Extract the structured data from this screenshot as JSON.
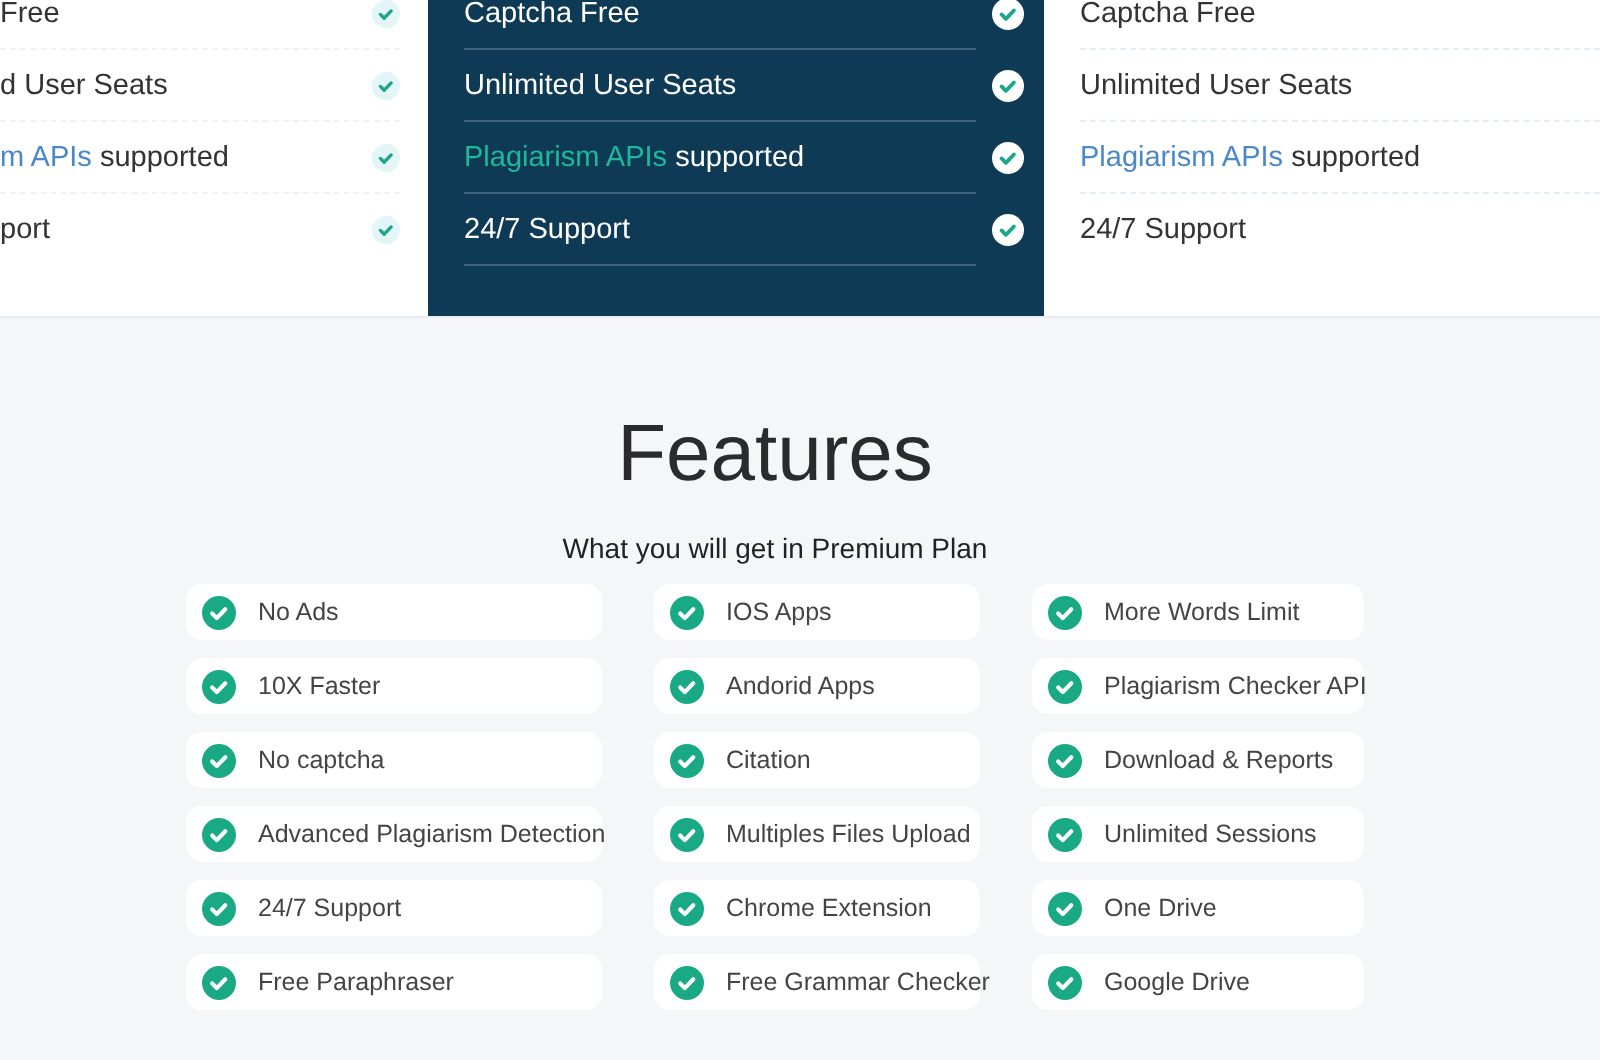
{
  "plans": [
    {
      "kind": "plain",
      "items": [
        {
          "text": "Free"
        },
        {
          "text": "d User Seats"
        },
        {
          "link": "m APIs",
          "text": " supported"
        },
        {
          "text": "port"
        }
      ]
    },
    {
      "kind": "featured",
      "items": [
        {
          "text": "Captcha Free"
        },
        {
          "text": "Unlimited User Seats"
        },
        {
          "link": "Plagiarism APIs",
          "text": " supported"
        },
        {
          "text": "24/7 Support"
        }
      ]
    },
    {
      "kind": "cut",
      "items": [
        {
          "text": "Captcha Free"
        },
        {
          "text": "Unlimited User Seats"
        },
        {
          "link": "Plagiarism APIs",
          "text": " supported"
        },
        {
          "text": "24/7 Support"
        }
      ]
    }
  ],
  "features": {
    "title": "Features",
    "subtitle": "What you will get in Premium Plan",
    "columns": [
      [
        "No Ads",
        "10X Faster",
        "No captcha",
        "Advanced Plagiarism Detection",
        "24/7 Support",
        "Free Paraphraser"
      ],
      [
        "IOS Apps",
        "Andorid Apps",
        "Citation",
        "Multiples Files Upload",
        "Chrome Extension",
        "Free Grammar Checker"
      ],
      [
        "More Words Limit",
        "Plagiarism Checker API",
        "Download & Reports",
        "Unlimited Sessions",
        "One Drive",
        "Google Drive"
      ]
    ]
  }
}
